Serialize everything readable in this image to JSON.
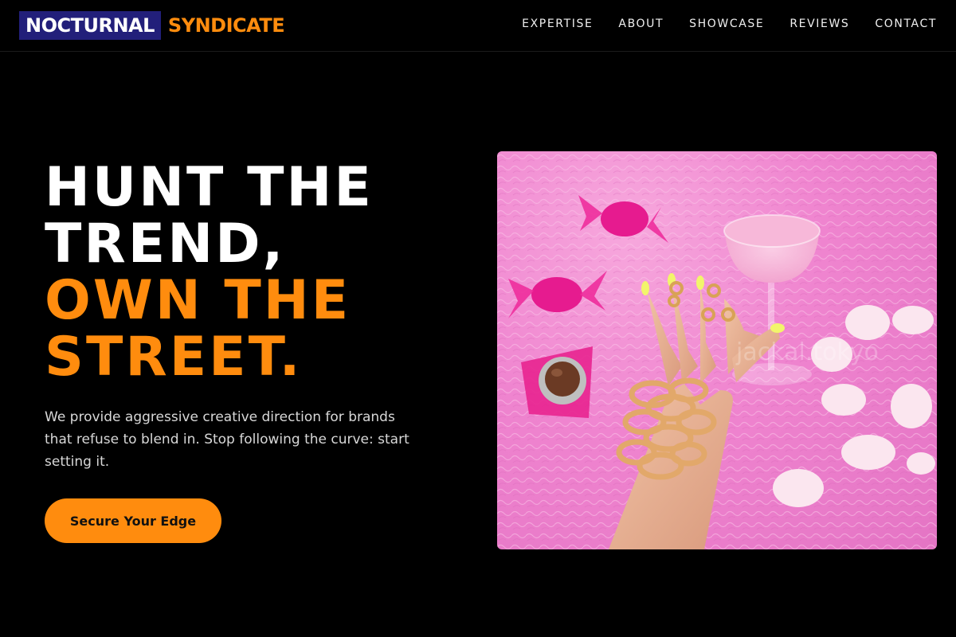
{
  "brand": {
    "name_primary": "NOCTURNAL",
    "name_accent": "SYNDICATE"
  },
  "nav": {
    "items": [
      {
        "label": "EXPERTISE"
      },
      {
        "label": "ABOUT"
      },
      {
        "label": "SHOWCASE"
      },
      {
        "label": "REVIEWS"
      },
      {
        "label": "CONTACT"
      }
    ]
  },
  "hero": {
    "title_lines": [
      "HUNT THE",
      "TREND,",
      "OWN THE",
      "STREET."
    ],
    "subtitle": "We provide aggressive creative direction for brands that refuse to blend in. Stop following the curve: start setting it.",
    "cta_label": "Secure Your Edge",
    "image_watermark": "jackal.tokyo"
  },
  "colors": {
    "background": "#000000",
    "accent": "#ff8c0e",
    "logo_box": "#221f7a",
    "text": "#ffffff"
  }
}
